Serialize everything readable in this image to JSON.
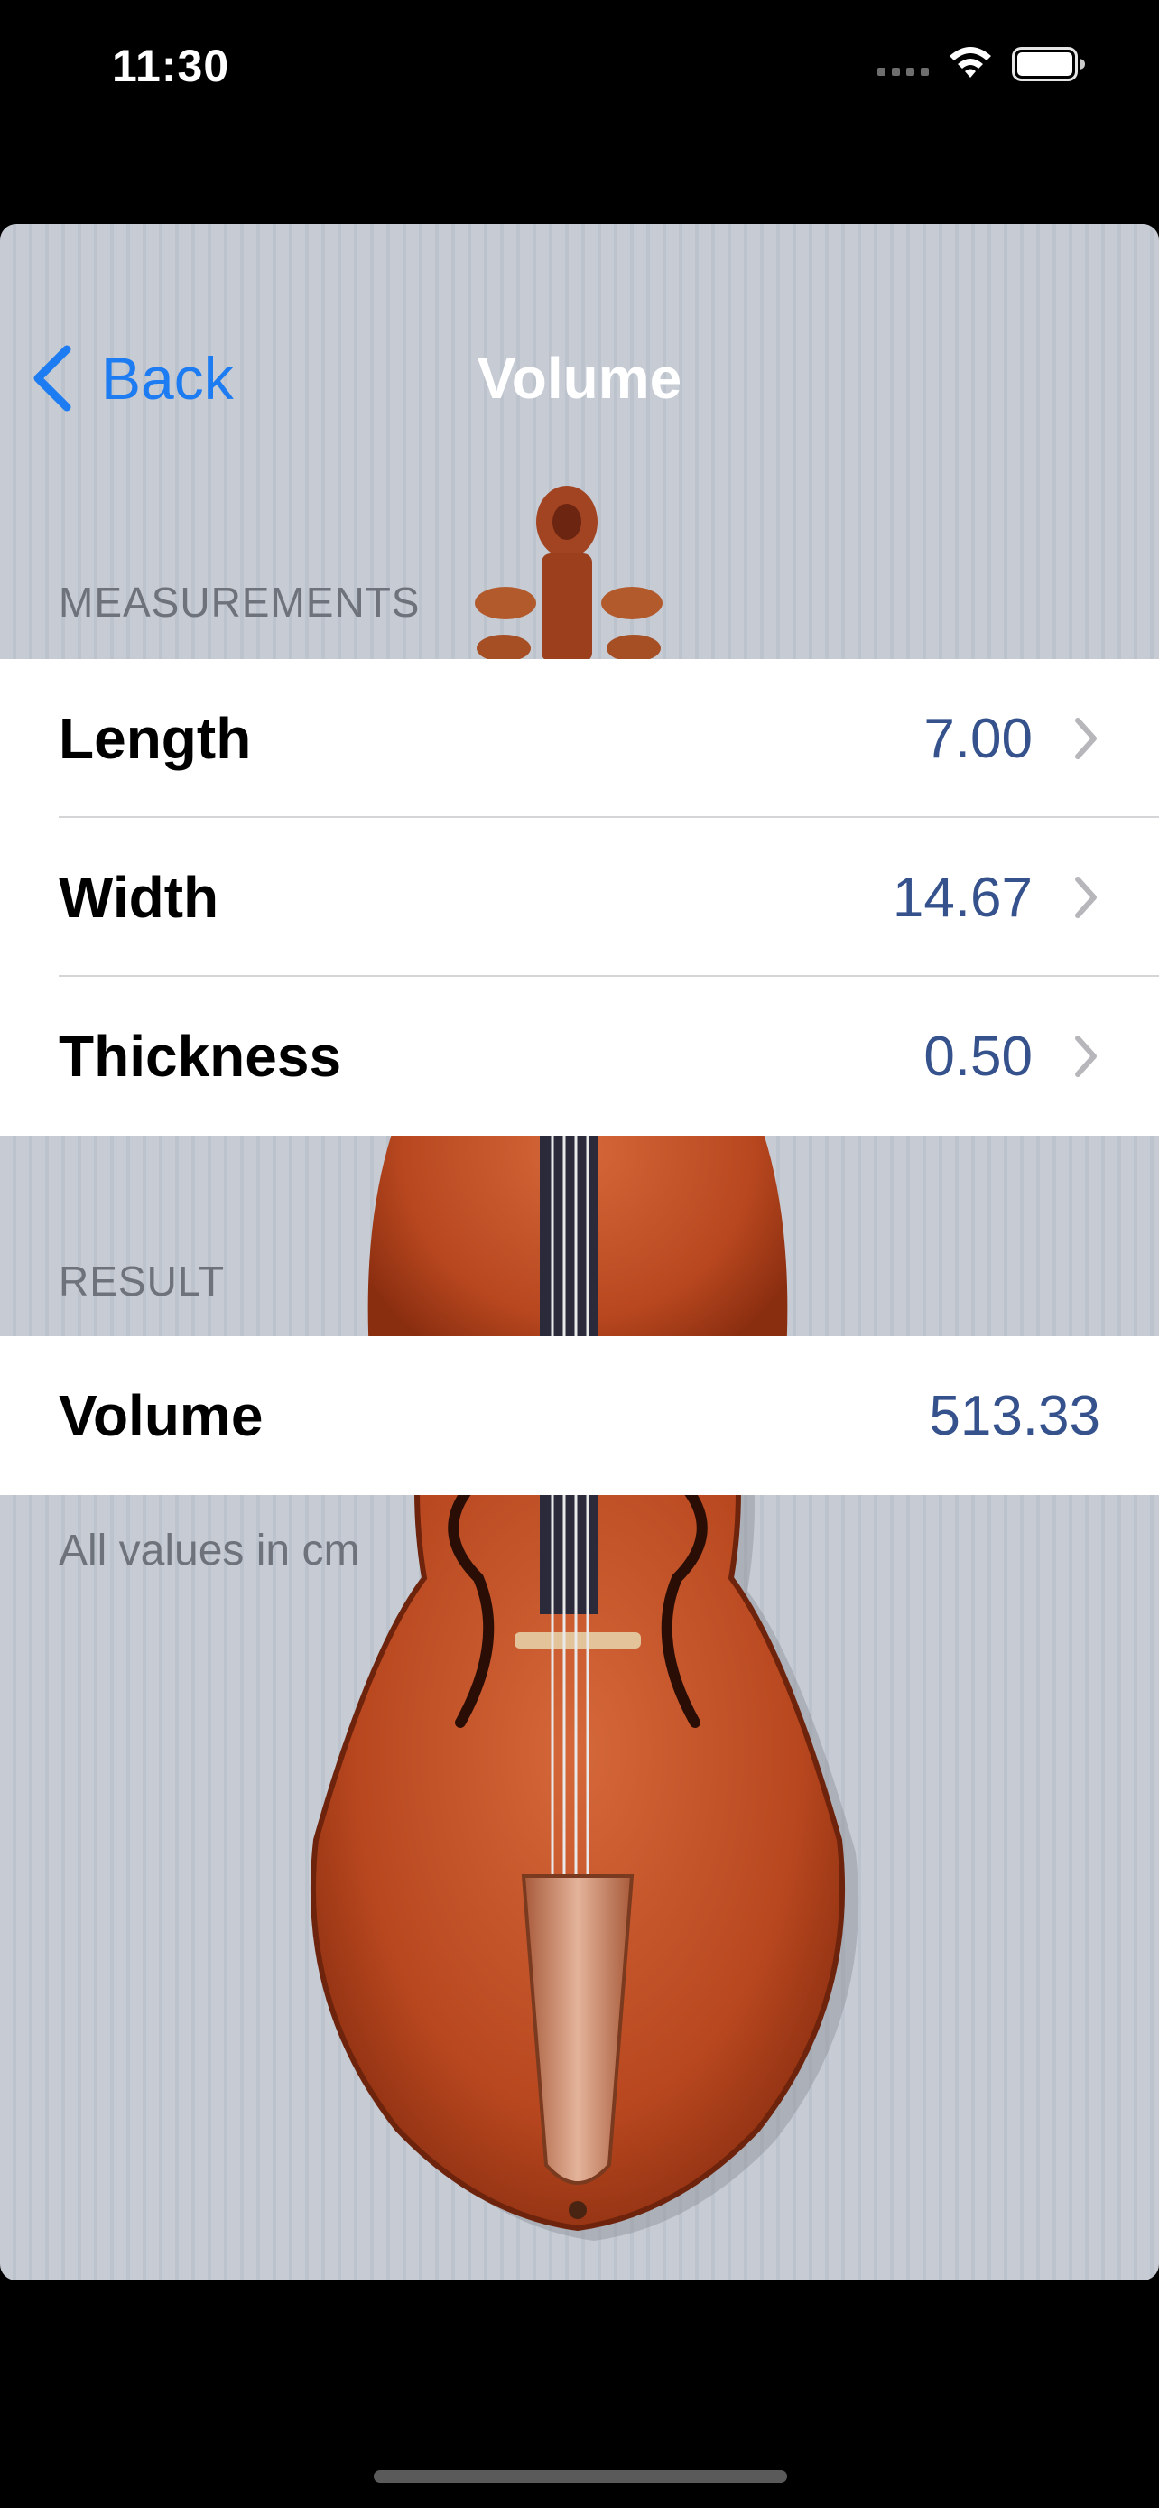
{
  "status_bar": {
    "time": "11:30",
    "icons": [
      "cellular-signal-icon",
      "wifi-icon",
      "battery-icon"
    ]
  },
  "nav": {
    "back_label": "Back",
    "title": "Volume"
  },
  "measurements": {
    "header": "MEASUREMENTS",
    "rows": [
      {
        "label": "Length",
        "value": "7.00"
      },
      {
        "label": "Width",
        "value": "14.67"
      },
      {
        "label": "Thickness",
        "value": "0.50"
      }
    ]
  },
  "result": {
    "header": "RESULT",
    "label": "Volume",
    "value": "513.33",
    "footer": "All values in cm"
  },
  "colors": {
    "accent": "#1d7cf2",
    "value_text": "#35528d",
    "background_stripes": "#c6cbd4"
  }
}
